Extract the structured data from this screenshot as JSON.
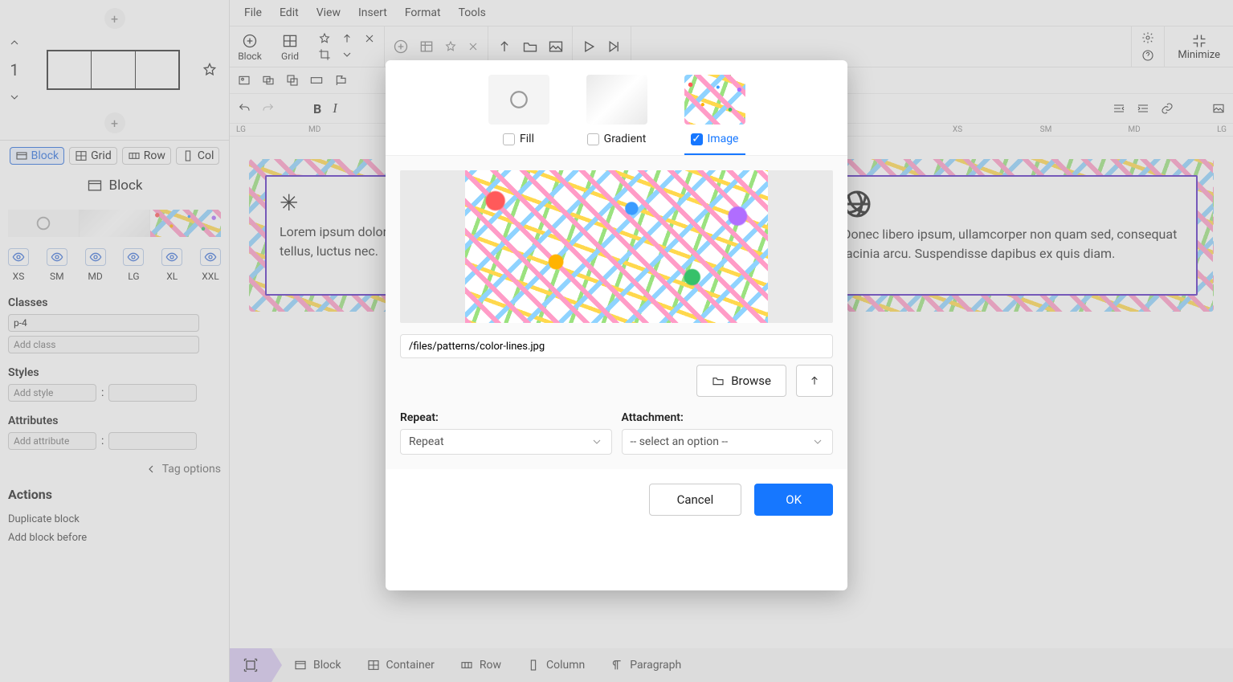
{
  "sidebar": {
    "pageNumber": "1",
    "insertButtons": [
      {
        "label": "Block",
        "active": true
      },
      {
        "label": "Grid",
        "active": false
      },
      {
        "label": "Row",
        "active": false
      },
      {
        "label": "Col",
        "active": false
      }
    ],
    "inspectorTitle": "Block",
    "breakpoints": [
      "XS",
      "SM",
      "MD",
      "LG",
      "XL",
      "XXL"
    ],
    "classes": {
      "title": "Classes",
      "existing": "p-4",
      "placeholder": "Add class"
    },
    "styles": {
      "title": "Styles",
      "placeholder": "Add style",
      "sep": ":"
    },
    "attributes": {
      "title": "Attributes",
      "placeholder": "Add attribute",
      "sep": ":"
    },
    "tagOptions": "Tag options",
    "actions": {
      "title": "Actions",
      "items": [
        "Duplicate block",
        "Add block before"
      ]
    }
  },
  "menubar": [
    "File",
    "Edit",
    "View",
    "Insert",
    "Format",
    "Tools"
  ],
  "toolbar": {
    "group1": [
      {
        "label": "Block"
      },
      {
        "label": "Grid"
      }
    ],
    "minimize": "Minimize"
  },
  "ruler": {
    "left": "LG",
    "md": "MD",
    "xs": "XS",
    "sm": "SM",
    "md2": "MD",
    "right": "LG"
  },
  "cards": {
    "leftText": "Lorem ipsum dolor sit amet, consectetur adipiscing elit tellus, luctus nec.",
    "rightText": "Donec libero ipsum, ullamcorper non quam sed, consequat lacinia arcu. Suspendisse dapibus ex quis diam."
  },
  "breadcrumb": [
    {
      "label": "",
      "active": true
    },
    {
      "label": "Block"
    },
    {
      "label": "Container"
    },
    {
      "label": "Row"
    },
    {
      "label": "Column"
    },
    {
      "label": "Paragraph"
    }
  ],
  "modal": {
    "tabs": [
      {
        "label": "Fill",
        "checked": false
      },
      {
        "label": "Gradient",
        "checked": false
      },
      {
        "label": "Image",
        "checked": true
      }
    ],
    "path": "/files/patterns/color-lines.jpg",
    "browse": "Browse",
    "repeat": {
      "label": "Repeat:",
      "value": "Repeat"
    },
    "attachment": {
      "label": "Attachment:",
      "value": "-- select an option --"
    },
    "cancel": "Cancel",
    "ok": "OK"
  }
}
